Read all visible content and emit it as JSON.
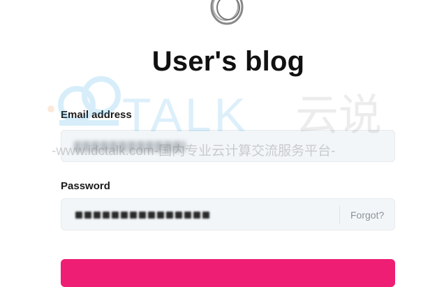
{
  "page": {
    "title": "User's blog"
  },
  "form": {
    "email_label": "Email address",
    "password_label": "Password",
    "forgot_label": "Forgot?",
    "accent_color": "#ee1e74"
  },
  "watermark": {
    "brand": "TALK",
    "brand_cn": "云说",
    "tagline": "-www.idctalk.com-国内专业云计算交流服务平台-"
  }
}
